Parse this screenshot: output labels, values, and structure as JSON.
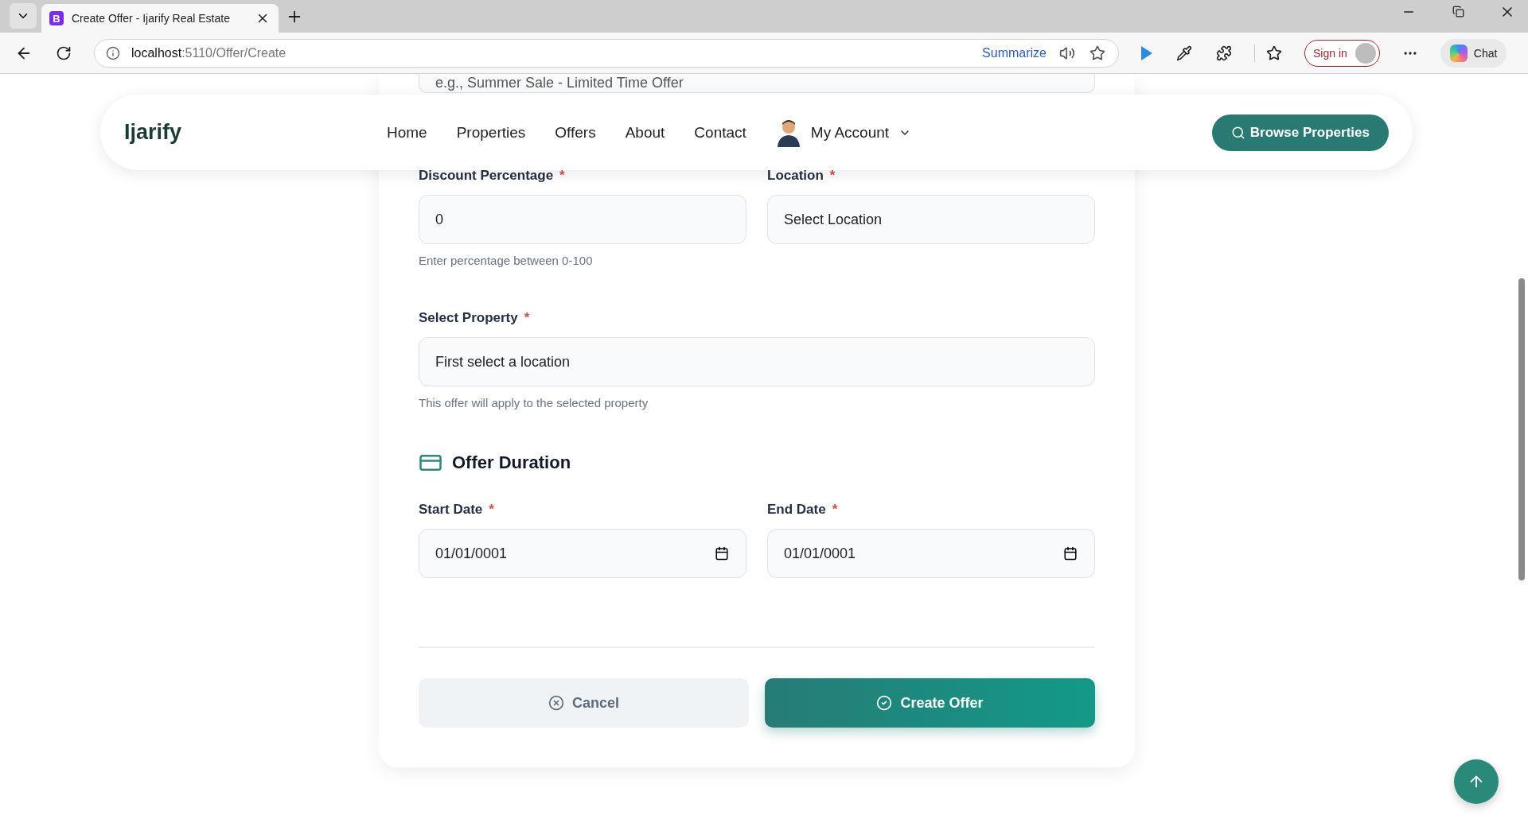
{
  "browser": {
    "tabs": [
      {
        "title": "Create Offer - Ijarify Real Estate",
        "favicon": "B",
        "selected": true
      }
    ],
    "url_host": "localhost",
    "url_path": ":5110/Offer/Create",
    "summarize": "Summarize",
    "sign_in": "Sign in",
    "chat": "Chat"
  },
  "nav": {
    "logo": "Ijarify",
    "links": [
      {
        "label": "Home",
        "selected": false
      },
      {
        "label": "Properties",
        "selected": false
      },
      {
        "label": "Offers",
        "selected": false
      },
      {
        "label": "About",
        "selected": false
      },
      {
        "label": "Contact",
        "selected": false
      }
    ],
    "account": "My Account",
    "browse": "Browse Properties"
  },
  "form": {
    "title_field": {
      "placeholder": "e.g., Summer Sale - Limited Time Offer"
    },
    "row_1": [
      {
        "label": "Discount Percentage",
        "required_mark": "*",
        "value": "0",
        "help": "Enter percentage between 0-100"
      },
      {
        "label": "Location",
        "required_mark": "*",
        "value": "Select Location"
      }
    ],
    "property": {
      "label": "Select Property",
      "required_mark": "*",
      "value": "First select a location",
      "help": "This offer will apply to the selected property"
    },
    "duration_heading": "Offer Duration",
    "dates": [
      {
        "label": "Start Date",
        "required_mark": "*",
        "value": "01/01/0001"
      },
      {
        "label": "End Date",
        "required_mark": "*",
        "value": "01/01/0001"
      }
    ],
    "cancel": "Cancel",
    "submit": "Create Offer"
  }
}
